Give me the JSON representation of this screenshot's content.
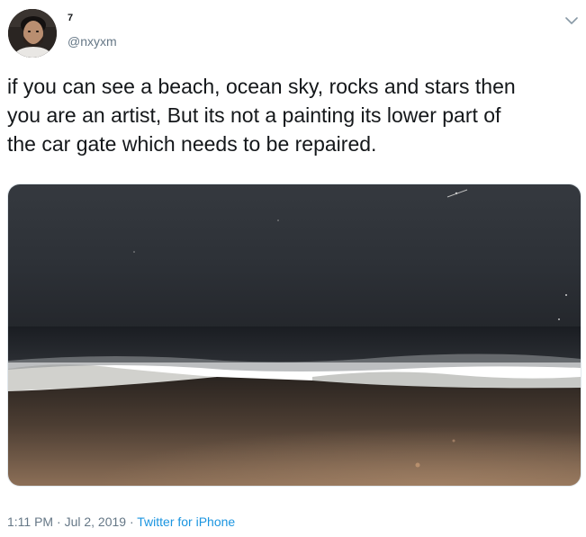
{
  "user": {
    "display_name": "7",
    "handle": "@nxyxm"
  },
  "tweet": {
    "text": "if you can see a beach, ocean sky, rocks and stars then\nyou are an artist, But its not a painting its lower part of\nthe car gate which needs to be repaired."
  },
  "meta": {
    "time": "1:11 PM",
    "separator_1": " · ",
    "date": "Jul 2, 2019",
    "separator_2": " · ",
    "source": "Twitter for iPhone"
  },
  "icons": {
    "menu": "chevron-down-icon"
  },
  "colors": {
    "text": "#14171a",
    "secondary": "#657786",
    "link": "#1b95e0"
  }
}
